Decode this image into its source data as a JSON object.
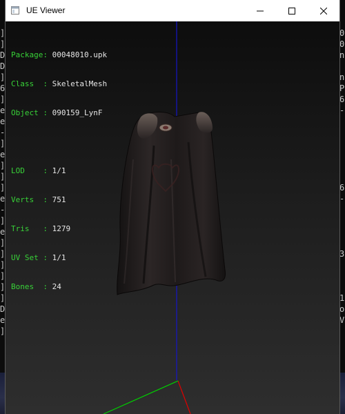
{
  "background_console": {
    "left_chars": [
      "]",
      "]",
      "D",
      "D",
      "]",
      "6",
      "]",
      "e",
      "e",
      "-",
      "]",
      "e",
      "]",
      "]",
      "]",
      "e",
      "-",
      "]",
      "e",
      "]",
      "]",
      "]",
      "]",
      "]",
      "]",
      "D",
      "e",
      "]"
    ],
    "right_chars": [
      "0",
      "0",
      "n",
      "",
      "n",
      "P",
      "6",
      "-",
      "",
      "",
      "",
      "",
      "",
      "",
      "6",
      "-",
      "",
      "",
      "",
      "",
      "3",
      "",
      "",
      "",
      "1",
      "o",
      "V",
      ""
    ]
  },
  "window": {
    "title": "UE Viewer",
    "app_icon": "window-icon",
    "controls": {
      "minimize_icon": "minimize-icon",
      "maximize_icon": "maximize-icon",
      "close_icon": "close-icon"
    }
  },
  "info": {
    "package": {
      "label": "Package:",
      "value": "00048010.upk"
    },
    "class": {
      "label": "Class  :",
      "value": "SkeletalMesh"
    },
    "object": {
      "label": "Object :",
      "value": "090159_LynF"
    },
    "lod": {
      "label": "LOD    :",
      "value": "1/1"
    },
    "verts": {
      "label": "Verts  :",
      "value": "751"
    },
    "tris": {
      "label": "Tris   :",
      "value": "1279"
    },
    "uvset": {
      "label": "UV Set :",
      "value": "1/1"
    },
    "bones": {
      "label": "Bones  :",
      "value": "24"
    }
  },
  "scene": {
    "mesh": "cape-mesh",
    "axis_colors": {
      "x": "#e00000",
      "y": "#00d000",
      "z": "#1515c8"
    }
  }
}
